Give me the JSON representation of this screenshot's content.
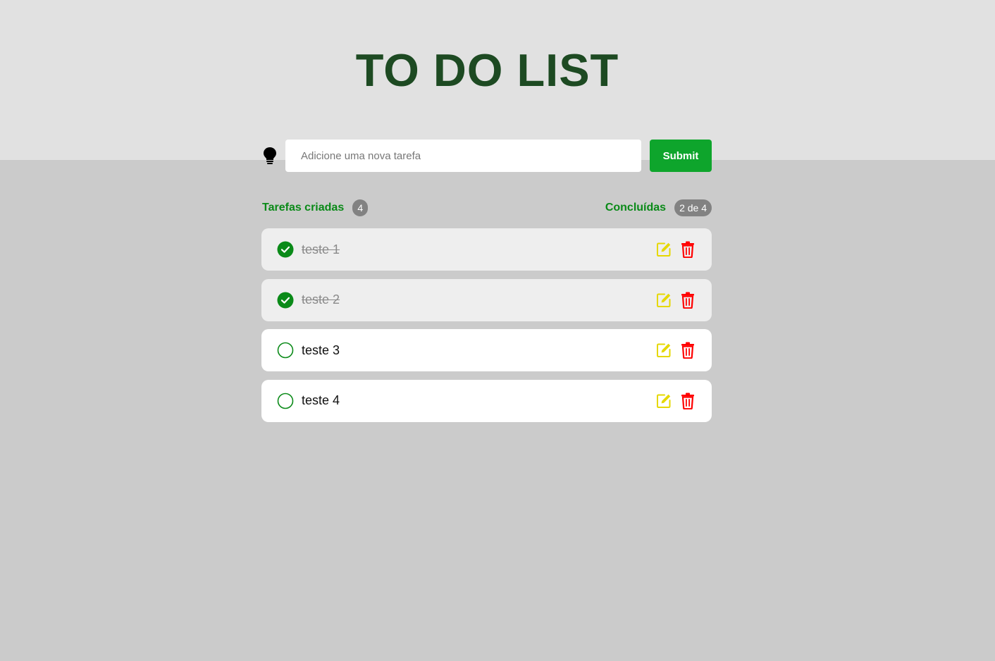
{
  "header": {
    "title": "TO DO LIST"
  },
  "form": {
    "placeholder": "Adicione uma nova tarefa",
    "submit_label": "Submit",
    "icon": "lightbulb-icon"
  },
  "stats": {
    "created_label": "Tarefas criadas",
    "created_count": "4",
    "done_label": "Concluídas",
    "done_count": "2 de 4"
  },
  "tasks": [
    {
      "text": "teste 1",
      "done": true
    },
    {
      "text": "teste 2",
      "done": true
    },
    {
      "text": "teste 3",
      "done": false
    },
    {
      "text": "teste 4",
      "done": false
    }
  ],
  "colors": {
    "accent": "#0a8a18",
    "submit": "#0ea52c",
    "edit": "#e6d800",
    "delete": "#ff0000",
    "title": "#1d4a22"
  }
}
